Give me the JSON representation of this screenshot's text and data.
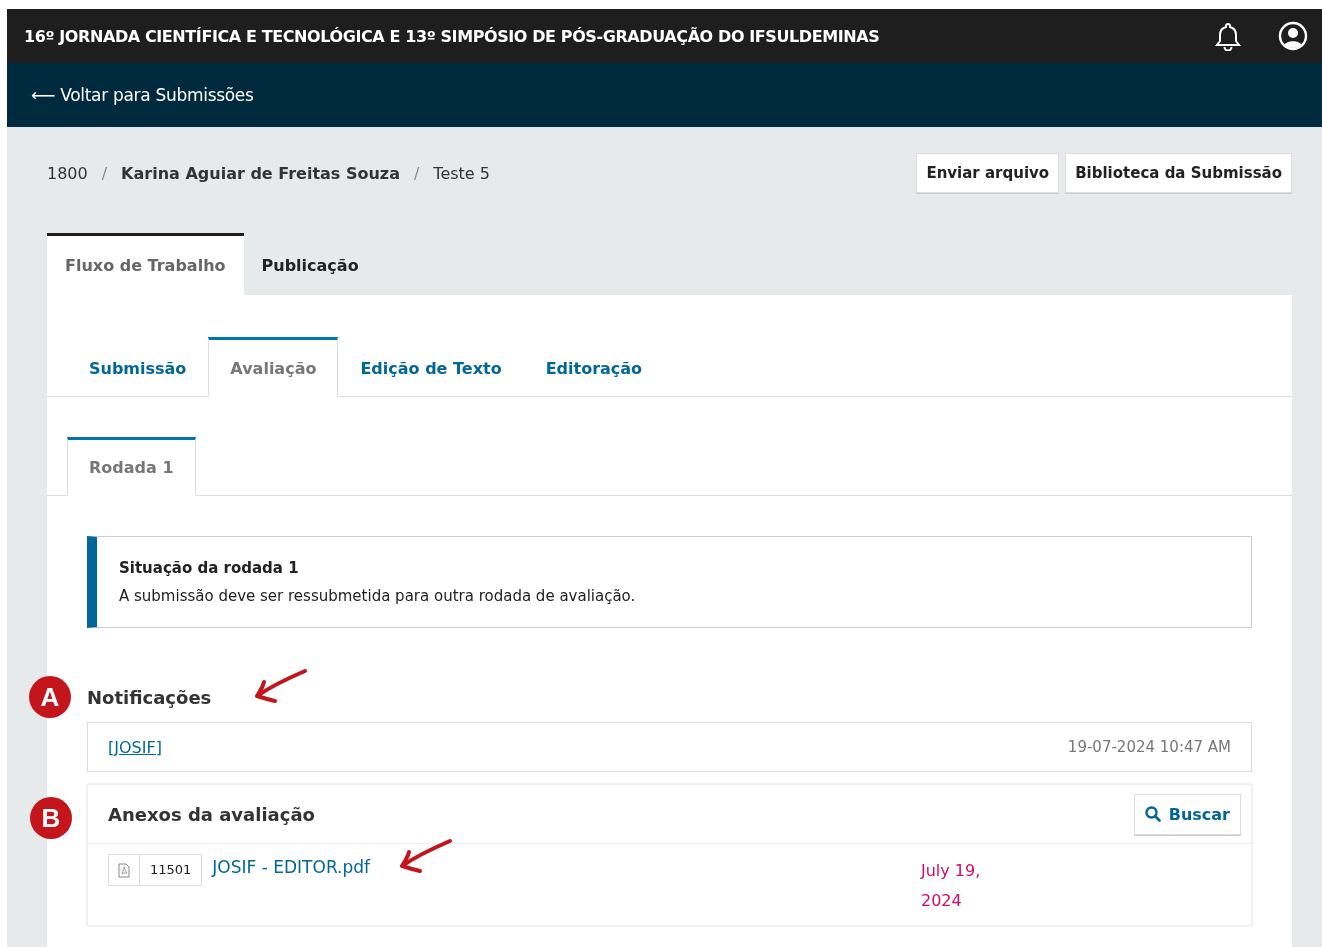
{
  "header": {
    "title": "16º JORNADA CIENTÍFICA E TECNOLÓGICA E 13º SIMPÓSIO DE PÓS-GRADUAÇÃO DO IFSULDEMINAS"
  },
  "back_link": "⟵ Voltar para Submissões",
  "breadcrumb": {
    "id": "1800",
    "separator_1": "/",
    "author": "Karina Aguiar de Freitas Souza",
    "separator_2": "/",
    "title": "Teste 5"
  },
  "actions": [
    "Enviar arquivo",
    "Biblioteca da Submissão"
  ],
  "tabs": [
    {
      "label": "Fluxo de Trabalho",
      "selected": true
    },
    {
      "label": "Publicação",
      "selected": false
    }
  ],
  "stage_tabs": [
    {
      "label": "Submissão",
      "selected": false
    },
    {
      "label": "Avaliação",
      "selected": true
    },
    {
      "label": "Edição de Texto",
      "selected": false
    },
    {
      "label": "Editoração",
      "selected": false
    }
  ],
  "round_tabs": [
    {
      "label": "Rodada 1",
      "selected": true
    }
  ],
  "round_status": {
    "title": "Situação da rodada 1",
    "message": "A submissão deve ser ressubmetida para outra rodada de avaliação."
  },
  "notifications": {
    "heading": "Notificações",
    "items": [
      {
        "subject": "[JOSIF]",
        "date": "19-07-2024 10:47 AM"
      }
    ]
  },
  "attachments": {
    "heading": "Anexos da avaliação",
    "search": "Buscar",
    "files": [
      {
        "id": "11501",
        "name": "JOSIF - EDITOR.pdf",
        "date": "July 19, 2024"
      }
    ]
  },
  "annotations": [
    {
      "letter": "A"
    },
    {
      "letter": "B"
    }
  ]
}
